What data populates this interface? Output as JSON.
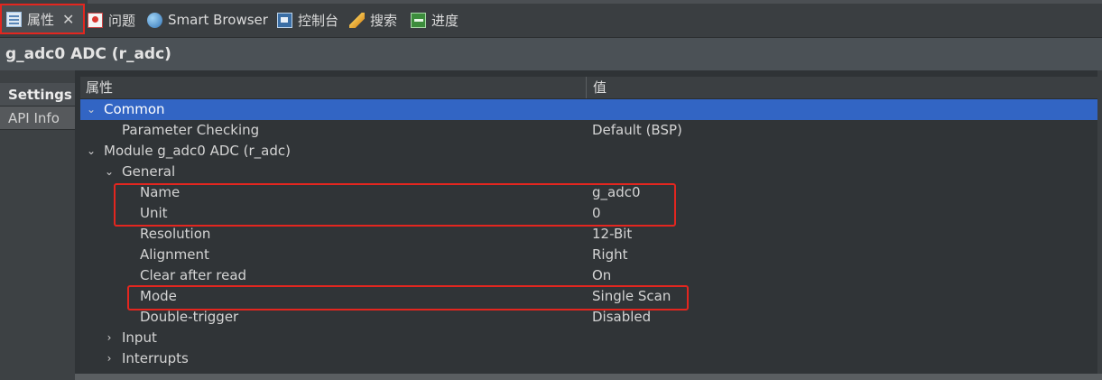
{
  "tabs": [
    {
      "label": "属性",
      "icon": "properties-icon",
      "active": true,
      "closable": true
    },
    {
      "label": "问题",
      "icon": "problems-icon"
    },
    {
      "label": "Smart Browser",
      "icon": "smart-browser-icon"
    },
    {
      "label": "控制台",
      "icon": "console-icon"
    },
    {
      "label": "搜索",
      "icon": "search-icon"
    },
    {
      "label": "进度",
      "icon": "progress-icon"
    }
  ],
  "close_glyph": "✕",
  "title": "g_adc0 ADC (r_adc)",
  "side_tabs": [
    "Settings",
    "API Info"
  ],
  "table": {
    "headers": {
      "property": "属性",
      "value": "值"
    },
    "rows": [
      {
        "label": "Common",
        "value": "",
        "twisty": "⌄",
        "selected": true
      },
      {
        "label": "Parameter Checking",
        "value": "Default (BSP)"
      },
      {
        "label": "Module g_adc0 ADC (r_adc)",
        "value": "",
        "twisty": "⌄"
      },
      {
        "label": "General",
        "value": "",
        "twisty": "⌄"
      },
      {
        "label": "Name",
        "value": "g_adc0"
      },
      {
        "label": "Unit",
        "value": "0"
      },
      {
        "label": "Resolution",
        "value": "12-Bit"
      },
      {
        "label": "Alignment",
        "value": "Right"
      },
      {
        "label": "Clear after read",
        "value": "On"
      },
      {
        "label": "Mode",
        "value": "Single Scan"
      },
      {
        "label": "Double-trigger",
        "value": "Disabled"
      },
      {
        "label": "Input",
        "value": "",
        "twisty": "›"
      },
      {
        "label": "Interrupts",
        "value": "",
        "twisty": "›"
      }
    ]
  },
  "colors": {
    "highlight": "#e3261f",
    "selection": "#3265c4",
    "background": "#303437"
  }
}
